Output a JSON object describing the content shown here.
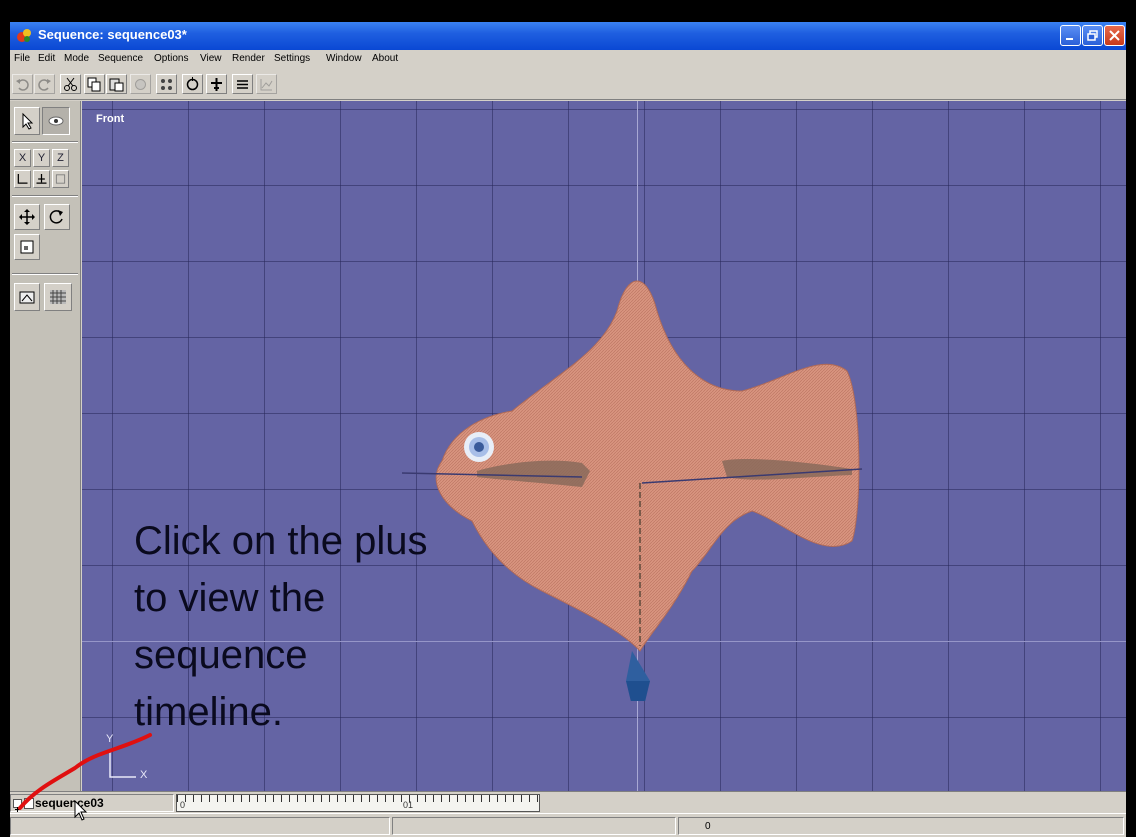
{
  "window": {
    "title": "Sequence: sequence03*",
    "controls": [
      "minimize",
      "restore",
      "close"
    ]
  },
  "menu": {
    "items": [
      "File",
      "Edit",
      "Mode",
      "Sequence",
      "Options",
      "View",
      "Render",
      "Settings",
      "Window",
      "About"
    ]
  },
  "toolbar": {
    "buttons": [
      "undo-icon",
      "redo-icon",
      "cut-icon",
      "copy-icon",
      "paste-icon",
      "render-icon",
      "dots-grid-icon",
      "rotate-icon",
      "snap-icon",
      "align-icon",
      "graph-icon"
    ]
  },
  "left_panel": {
    "axis_x": "X",
    "axis_y": "Y",
    "axis_z": "Z"
  },
  "viewport": {
    "view_label": "Front",
    "gizmo_y": "Y",
    "gizmo_x": "X"
  },
  "caption": {
    "line1": "Click on the plus",
    "line2": "to view the",
    "line3": "sequence",
    "line4": "timeline."
  },
  "timeline": {
    "sequence_name": "sequence03",
    "ruler_start": "0",
    "ruler_mark": "01"
  },
  "status": {
    "frame_value": "0"
  },
  "colors": {
    "viewport_bg": "#6464a4",
    "fish_body": "#d48f7e",
    "titlebar": "#0a48d4",
    "annotation": "#e01010"
  }
}
